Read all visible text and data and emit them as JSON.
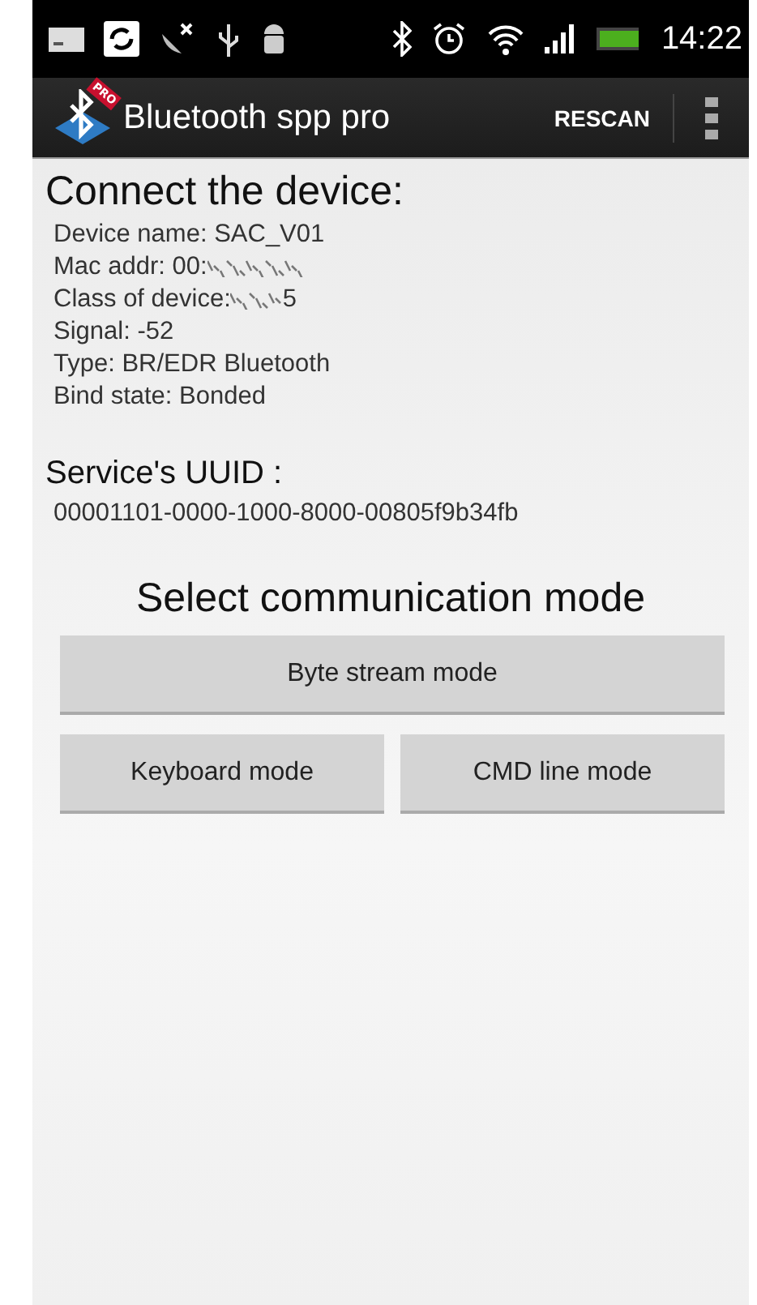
{
  "status_bar": {
    "time": "14:22"
  },
  "app_bar": {
    "title": "Bluetooth spp pro",
    "badge": "PRO",
    "action": "RESCAN"
  },
  "device": {
    "heading": "Connect the device:",
    "details": [
      {
        "kind": "plain",
        "text": "Device name: SAC_V01"
      },
      {
        "kind": "redacted",
        "text": "Mac addr: 00:"
      },
      {
        "kind": "redacted",
        "text": "Class of device:",
        "tail": "5"
      },
      {
        "kind": "plain",
        "text": "Signal: -52"
      },
      {
        "kind": "plain",
        "text": "Type: BR/EDR Bluetooth"
      },
      {
        "kind": "plain",
        "text": "Bind state: Bonded"
      }
    ]
  },
  "service": {
    "heading": "Service's UUID :",
    "uuid": "00001101-0000-1000-8000-00805f9b34fb"
  },
  "modes": {
    "heading": "Select communication mode",
    "buttons": [
      [
        {
          "label": "Byte stream mode"
        }
      ],
      [
        {
          "label": "Keyboard mode"
        },
        {
          "label": "CMD line mode"
        }
      ]
    ]
  }
}
